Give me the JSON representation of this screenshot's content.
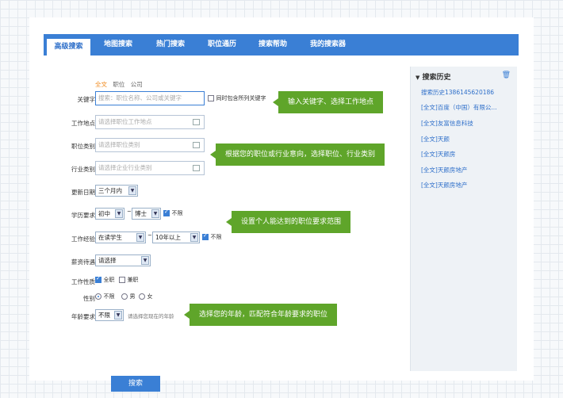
{
  "tabs": [
    {
      "label": "高级搜索",
      "active": true
    },
    {
      "label": "地图搜索"
    },
    {
      "label": "热门搜索"
    },
    {
      "label": "职位通历"
    },
    {
      "label": "搜索帮助"
    },
    {
      "label": "我的搜索器"
    }
  ],
  "scope": {
    "all": "全文",
    "position": "职位",
    "company": "公司"
  },
  "form": {
    "keyword_label": "关键字",
    "keyword_placeholder": "搜索：职位名称、公司或关键字",
    "keyword_opt": "同时包含所列关键字",
    "location_label": "工作地点",
    "location_placeholder": "请选择职位工作地点",
    "category_label": "职位类别",
    "category_placeholder": "请选择职位类别",
    "industry_label": "行业类别",
    "industry_placeholder": "请选择企业行业类别",
    "update_label": "更新日期",
    "update_value": "三个月内",
    "edu_label": "学历要求",
    "edu_from": "初中",
    "edu_sep": "~",
    "edu_to": "博士",
    "edu_unlimited": "不限",
    "exp_label": "工作经验",
    "exp_from": "在读学生",
    "exp_sep": "~",
    "exp_to": "10年以上",
    "exp_unlimited": "不限",
    "salary_label": "薪资待遇",
    "salary_value": "请选择",
    "nature_label": "工作性质",
    "nature_full": "全职",
    "nature_part": "兼职",
    "gender_label": "性别",
    "gender_any": "不限",
    "gender_male": "男",
    "gender_female": "女",
    "age_label": "年龄要求",
    "age_value": "不限",
    "age_placeholder": "请选择您现在的年龄",
    "search_button": "搜索"
  },
  "tips": {
    "tip1": "输入关键字、选择工作地点",
    "tip2": "根据您的职位或行业意向，选择职位、行业类别",
    "tip3": "设置个人能达到的职位要求范围",
    "tip4": "选择您的年龄，匹配符合年龄要求的职位"
  },
  "history": {
    "title": "搜索历史",
    "items": [
      "搜索历史1386145620186",
      "[全文]百度（中国）有限公...",
      "[全文]友富信息科技",
      "[全文]天颜",
      "[全文]天颜房",
      "[全文]天颜房地产",
      "[全文]天颜房地产"
    ]
  },
  "colors": {
    "accent": "#3a7fd5",
    "tip": "#5fa52a"
  }
}
